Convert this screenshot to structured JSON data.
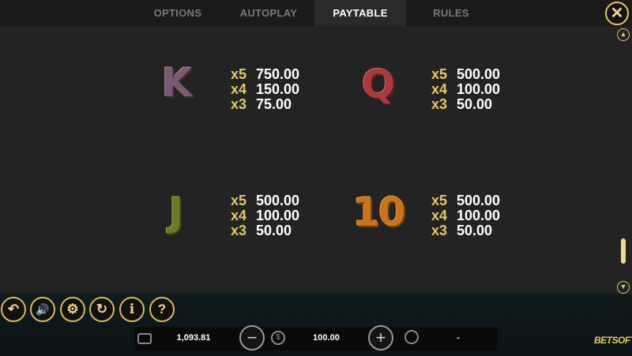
{
  "tabs": [
    {
      "label": "OPTIONS"
    },
    {
      "label": "AUTOPLAY"
    },
    {
      "label": "PAYTABLE"
    },
    {
      "label": "RULES"
    }
  ],
  "active_tab": "PAYTABLE",
  "close_label": "✕",
  "paytable": [
    {
      "symbol": "K",
      "pays": [
        {
          "mult": "x5",
          "amount": "750.00"
        },
        {
          "mult": "x4",
          "amount": "150.00"
        },
        {
          "mult": "x3",
          "amount": "75.00"
        }
      ]
    },
    {
      "symbol": "Q",
      "pays": [
        {
          "mult": "x5",
          "amount": "500.00"
        },
        {
          "mult": "x4",
          "amount": "100.00"
        },
        {
          "mult": "x3",
          "amount": "50.00"
        }
      ]
    },
    {
      "symbol": "J",
      "pays": [
        {
          "mult": "x5",
          "amount": "500.00"
        },
        {
          "mult": "x4",
          "amount": "100.00"
        },
        {
          "mult": "x3",
          "amount": "50.00"
        }
      ]
    },
    {
      "symbol": "10",
      "pays": [
        {
          "mult": "x5",
          "amount": "500.00"
        },
        {
          "mult": "x4",
          "amount": "100.00"
        },
        {
          "mult": "x3",
          "amount": "50.00"
        }
      ]
    }
  ],
  "controls": {
    "back_icon": "↶",
    "sound_icon": "🔊",
    "settings_icon": "⚙",
    "autoplay_icon": "↻",
    "info_icon": "i",
    "help_icon": "?"
  },
  "footer": {
    "balance": "1,093.81",
    "bet": "100.00",
    "win": "-",
    "minus_label": "−",
    "plus_label": "+",
    "logo": "BETSOFT"
  },
  "colors": {
    "accent": "#e5c76b",
    "background": "#232323"
  }
}
